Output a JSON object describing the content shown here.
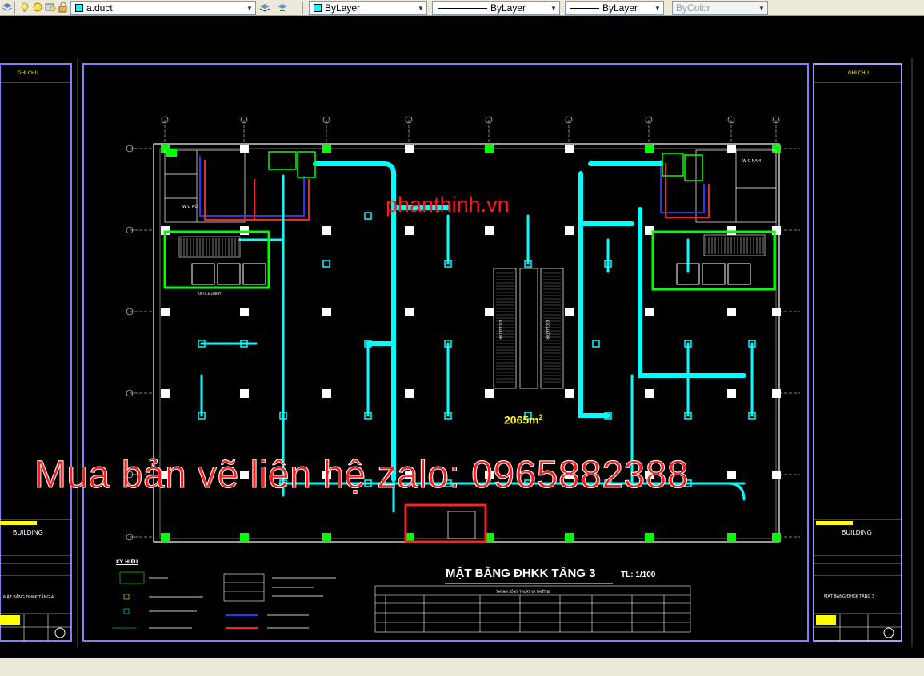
{
  "toolbar": {
    "layer_name": "a.duct",
    "color_value": "ByLayer",
    "linetype_value": "ByLayer",
    "lineweight_value": "ByLayer",
    "plotstyle_value": "ByColor",
    "layer_swatch_color": "#00ffff"
  },
  "drawing": {
    "watermark_site": "phanthinh.vn",
    "watermark_contact": "Mua bản vẽ liên hệ zalo: 0965882388",
    "area_label": "2065m",
    "area_unit_sup": "2",
    "plan_title": "MẶT BẰNG ĐHKK TẦNG 3",
    "plan_scale": "TL: 1/100",
    "left_sheet_notes": "GHI CHÚ",
    "right_sheet_notes": "GHI CHÚ",
    "left_building": "BUILDING",
    "right_building": "BUILDING",
    "left_sheet_name": "MẶT BẰNG ĐHKK TẦNG 4",
    "right_sheet_name": "MẶT BẰNG ĐHKK TẦNG 3",
    "escalator_label_1": "ESCALATOR",
    "escalator_label_2": "ESCALATOR",
    "wc_nam_label": "W C NAM",
    "wc_nu_label": "W C NỮ",
    "office_lobby": "OFFICE LOBBY",
    "legend_title": "KÝ HIỆU",
    "spec_header": "THÔNG SỐ KỸ THUẬT VÀ THIẾT BỊ"
  },
  "colors": {
    "toolbar_bg": "#ece9d8",
    "canvas_bg": "#000000",
    "wall_color": "#ffffff",
    "duct_color": "#00ffff",
    "equipment_color": "#00ff00",
    "frame_color": "#8080ff",
    "watermark_color": "#ff1a1a",
    "grid_color": "#ffffff"
  }
}
